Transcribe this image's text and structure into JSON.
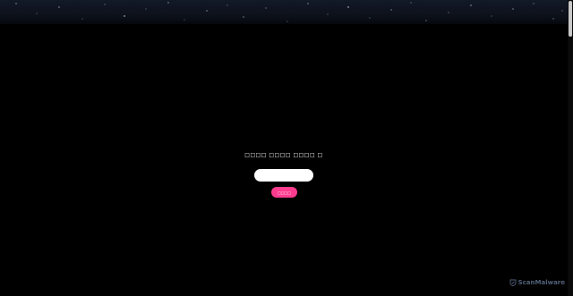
{
  "form": {
    "question_text": "□□□□ □□□□ □□□□ □",
    "input_value": "",
    "input_placeholder": "",
    "submit_label": "□□□□"
  },
  "watermark": {
    "text": "ScanMalware"
  },
  "icons": {
    "watermark_logo": "scanmalware-logo-icon"
  },
  "colors": {
    "background": "#000000",
    "header_band": "#0c1019",
    "button": "#ff3b8e",
    "watermark": "#7a93b8"
  }
}
